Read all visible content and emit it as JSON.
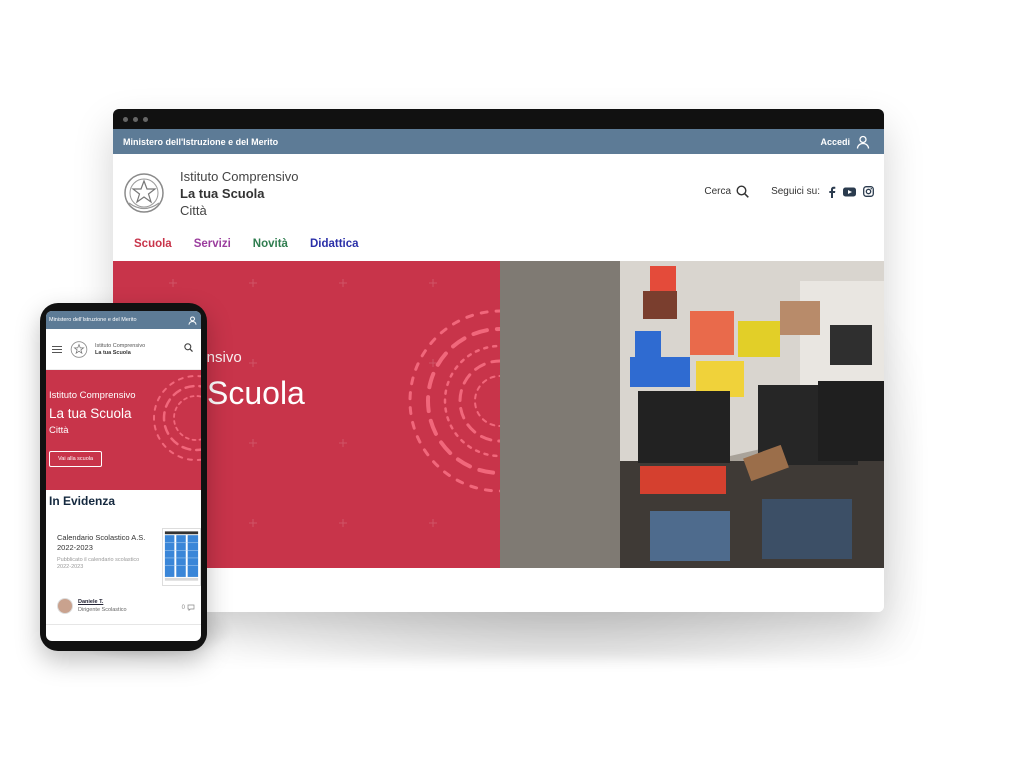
{
  "colors": {
    "topbar": "#5d7b96",
    "hero_red": "#c8344a",
    "nav_scuola": "#c8344a",
    "nav_servizi": "#9b3d9e",
    "nav_novita": "#2f7d4f",
    "nav_didattica": "#2a2fa8",
    "highlight_title": "#15293f"
  },
  "desktop": {
    "topbar": {
      "ministry": "Ministero dell'Istruzione e del Merito",
      "login_label": "Accedi"
    },
    "header": {
      "institute_type": "Istituto Comprensivo",
      "school_name": "La tua Scuola",
      "city": "Città",
      "search_label": "Cerca",
      "follow_label": "Seguici su:",
      "social_icons": [
        "facebook-icon",
        "youtube-icon",
        "instagram-icon"
      ]
    },
    "nav": {
      "items": [
        "Scuola",
        "Servizi",
        "Novità",
        "Didattica"
      ]
    },
    "hero": {
      "subtitle": "prensivo",
      "title": "Scuola"
    }
  },
  "phone": {
    "topbar": {
      "ministry": "Ministero dell'Istruzione e del Merito"
    },
    "header": {
      "institute_type": "Istituto Comprensivo",
      "school_name": "La tua Scuola"
    },
    "hero": {
      "institute_type": "Istituto Comprensivo",
      "school_name": "La tua Scuola",
      "city": "Città",
      "cta_label": "Vai alla scuola"
    },
    "highlight": {
      "heading": "In Evidenza",
      "card": {
        "title": "Calendario Scolastico A.S. 2022-2023",
        "description": "Pubblicato il calendario scolastico 2022-2023",
        "author_name": "Daniele T.",
        "author_role": "Dirigente Scolastico",
        "comments_count": "0"
      }
    }
  }
}
